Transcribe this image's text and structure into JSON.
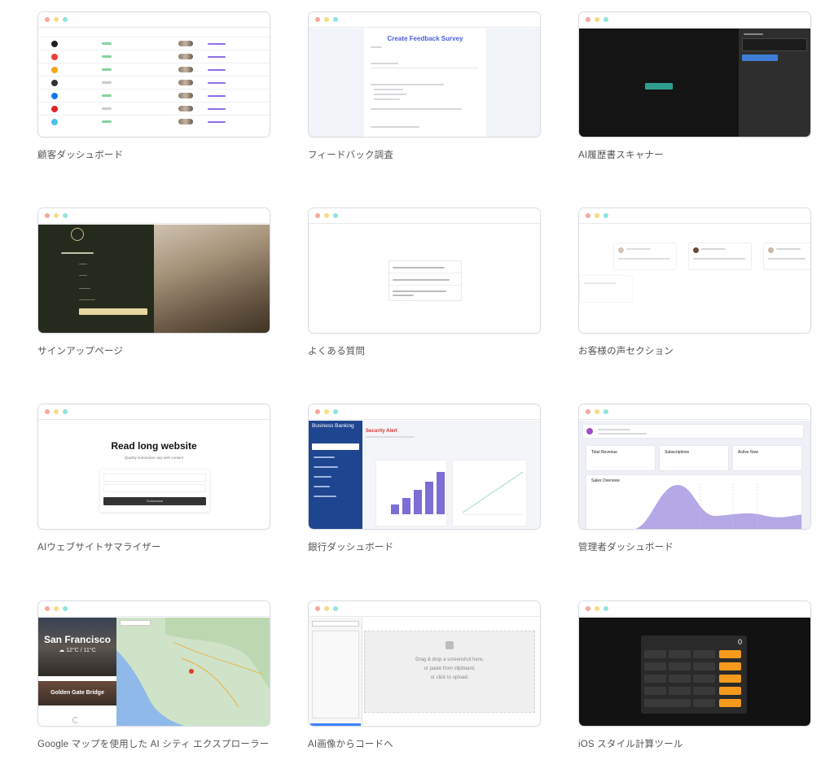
{
  "cards": [
    {
      "id": "customer-dashboard",
      "caption": "顧客ダッシュボード"
    },
    {
      "id": "feedback-survey",
      "caption": "フィードバック調査",
      "preview_title": "Create Feedback Survey"
    },
    {
      "id": "ai-resume-scanner",
      "caption": "AI履歴書スキャナー"
    },
    {
      "id": "signup-page",
      "caption": "サインアップページ"
    },
    {
      "id": "faq",
      "caption": "よくある質問"
    },
    {
      "id": "testimonials",
      "caption": "お客様の声セクション"
    },
    {
      "id": "ai-website-summarizer",
      "caption": "AIウェブサイトサマライザー",
      "preview_title": "Read long website",
      "preview_subtitle": "Quickly summarize any web content",
      "preview_button": "Summarize"
    },
    {
      "id": "bank-dashboard",
      "caption": "銀行ダッシュボード",
      "sidebar_title": "Business Banking",
      "alert": "Security Alert"
    },
    {
      "id": "admin-dashboard",
      "caption": "管理者ダッシュボード",
      "stat1": "Total Revenue",
      "stat2": "Subscriptions",
      "stat3": "Active Now",
      "chart_title": "Sales Overview"
    },
    {
      "id": "ai-city-explorer",
      "caption": "Google マップを使用した AI シティ エクスプローラー",
      "city": "San Francisco",
      "weather": "☁ 12°C / 11°C",
      "landmark": "Golden Gate Bridge"
    },
    {
      "id": "ai-image-to-code",
      "caption": "AI画像からコードへ",
      "drop1": "Drag & drop a screenshot here,",
      "drop2": "or paste from clipboard,",
      "drop3": "or click to upload."
    },
    {
      "id": "ios-calculator",
      "caption": "iOS スタイル計算ツール",
      "display": "0"
    }
  ],
  "colors": {
    "accent_blue": "#4a5fe0",
    "bank_sidebar": "#1e4590",
    "admin_chart": "#b4a8e6",
    "calc_orange": "#f59a1c"
  }
}
